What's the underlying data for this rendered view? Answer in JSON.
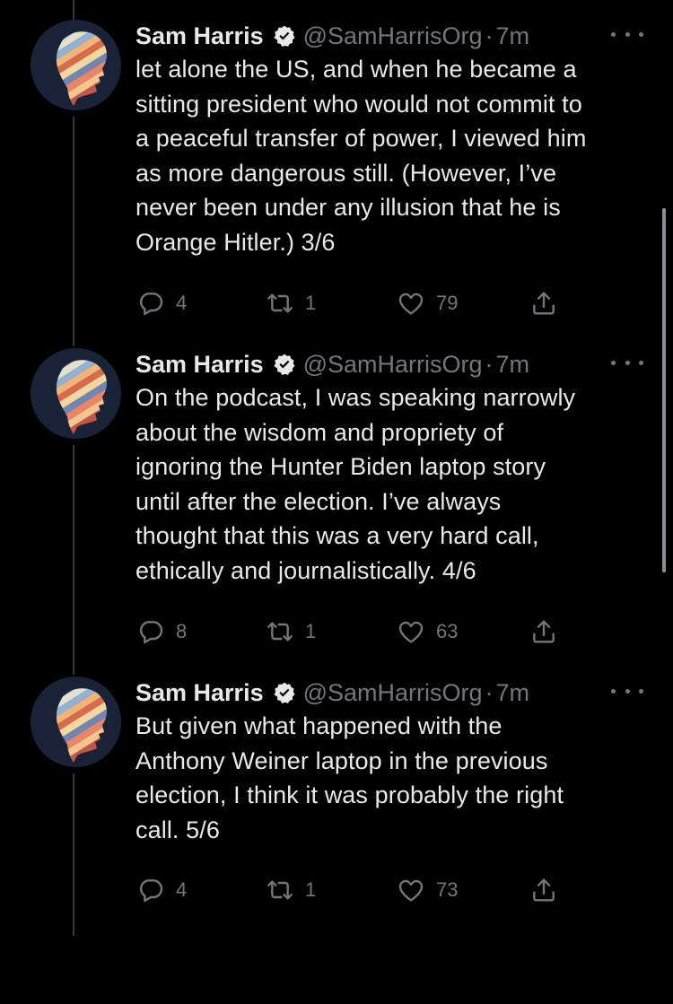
{
  "tweets": [
    {
      "name": "Sam Harris",
      "handle": "@SamHarrisOrg",
      "separator": "·",
      "time": "7m",
      "lines": [
        "let alone the US, and when he became a",
        "sitting president who would not commit to",
        "a peaceful transfer of power, I viewed him",
        "as more dangerous still. (However, I’ve",
        "never been under any illusion that he is",
        "Orange Hitler.) 3/6"
      ],
      "replies": "4",
      "retweets": "1",
      "likes": "79"
    },
    {
      "name": "Sam Harris",
      "handle": "@SamHarrisOrg",
      "separator": "·",
      "time": "7m",
      "lines": [
        "On the podcast, I was speaking narrowly",
        "about the wisdom and propriety of",
        "ignoring the Hunter Biden laptop story",
        "until after the election. I’ve always",
        "thought that this was a very hard call,",
        "ethically and journalistically. 4/6"
      ],
      "replies": "8",
      "retweets": "1",
      "likes": "63"
    },
    {
      "name": "Sam Harris",
      "handle": "@SamHarrisOrg",
      "separator": "·",
      "time": "7m",
      "lines": [
        "But given what happened with the",
        "Anthony Weiner laptop in the previous",
        "election, I think it was probably the right",
        "call. 5/6"
      ],
      "replies": "4",
      "retweets": "1",
      "likes": "73"
    }
  ],
  "icons": {
    "verified": "verified-badge-icon",
    "more": "more-options-icon",
    "reply": "reply-icon",
    "retweet": "retweet-icon",
    "like": "heart-icon",
    "share": "share-icon"
  },
  "colors": {
    "background": "#000000",
    "text": "#e7e9ea",
    "secondary": "#71767b",
    "verified": "#e7e9ea"
  }
}
